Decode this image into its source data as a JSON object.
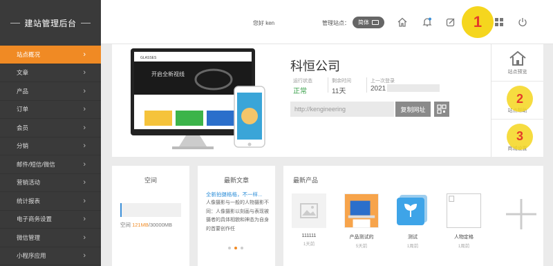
{
  "brand": {
    "title": "建站管理后台"
  },
  "sidebar": {
    "items": [
      {
        "label": "站点概况",
        "active": true
      },
      {
        "label": "文章"
      },
      {
        "label": "产品"
      },
      {
        "label": "订单"
      },
      {
        "label": "会员"
      },
      {
        "label": "分销"
      },
      {
        "label": "邮件/短信/微信"
      },
      {
        "label": "营销活动"
      },
      {
        "label": "统计报表"
      },
      {
        "label": "电子商务设置"
      },
      {
        "label": "微信管理"
      },
      {
        "label": "小程序应用"
      }
    ]
  },
  "topbar": {
    "greeting": "您好 ken",
    "manage_label": "管理站点：",
    "lang_label": "简体",
    "icons": [
      "home-icon",
      "bell-icon",
      "edit-icon",
      "grid-icon",
      "power-icon"
    ],
    "highlight_number": "1"
  },
  "overview": {
    "company": "科恒公司",
    "stats": [
      {
        "label": "运行状态",
        "value": "正常"
      },
      {
        "label": "剩余时间",
        "value": "11天"
      },
      {
        "label": "上一次登录",
        "value": "2021"
      }
    ],
    "url": "http://kengineering",
    "copy_label": "复制网址",
    "mockup_logo": "GLASSES",
    "mockup_banner": "开启全新视线",
    "mockup_banner_sub": "开启全新视线"
  },
  "side_actions": [
    {
      "label": "站点预览",
      "icon": "house-icon"
    },
    {
      "label": "站点帮助",
      "number": "2"
    },
    {
      "label": "商城设置",
      "number": "3"
    }
  ],
  "space_card": {
    "title": "空间",
    "usage_prefix": "空间 ",
    "used": "121MB",
    "total": "/30000MB"
  },
  "article_card": {
    "title": "最新文章",
    "headline": "全新拍摄格格，不一样...",
    "body": "人像摄影与一般的人物摄影不同：人像摄影以刻画与表现被摄者的具体相貌和神态为自身的首要创作任"
  },
  "product_card": {
    "title": "最新产品",
    "products": [
      {
        "name": "111111",
        "date": "1天前"
      },
      {
        "name": "产品测试的",
        "date": "5天前"
      },
      {
        "name": "测试",
        "date": "1周前"
      },
      {
        "name": "人物定格",
        "date": "1周前"
      }
    ]
  },
  "colors": {
    "accent": "#f08a24",
    "sidebar": "#3a3a3a",
    "badge": "#f5d61e",
    "badge_text": "#e53a2b",
    "link": "#2f8fd8"
  }
}
